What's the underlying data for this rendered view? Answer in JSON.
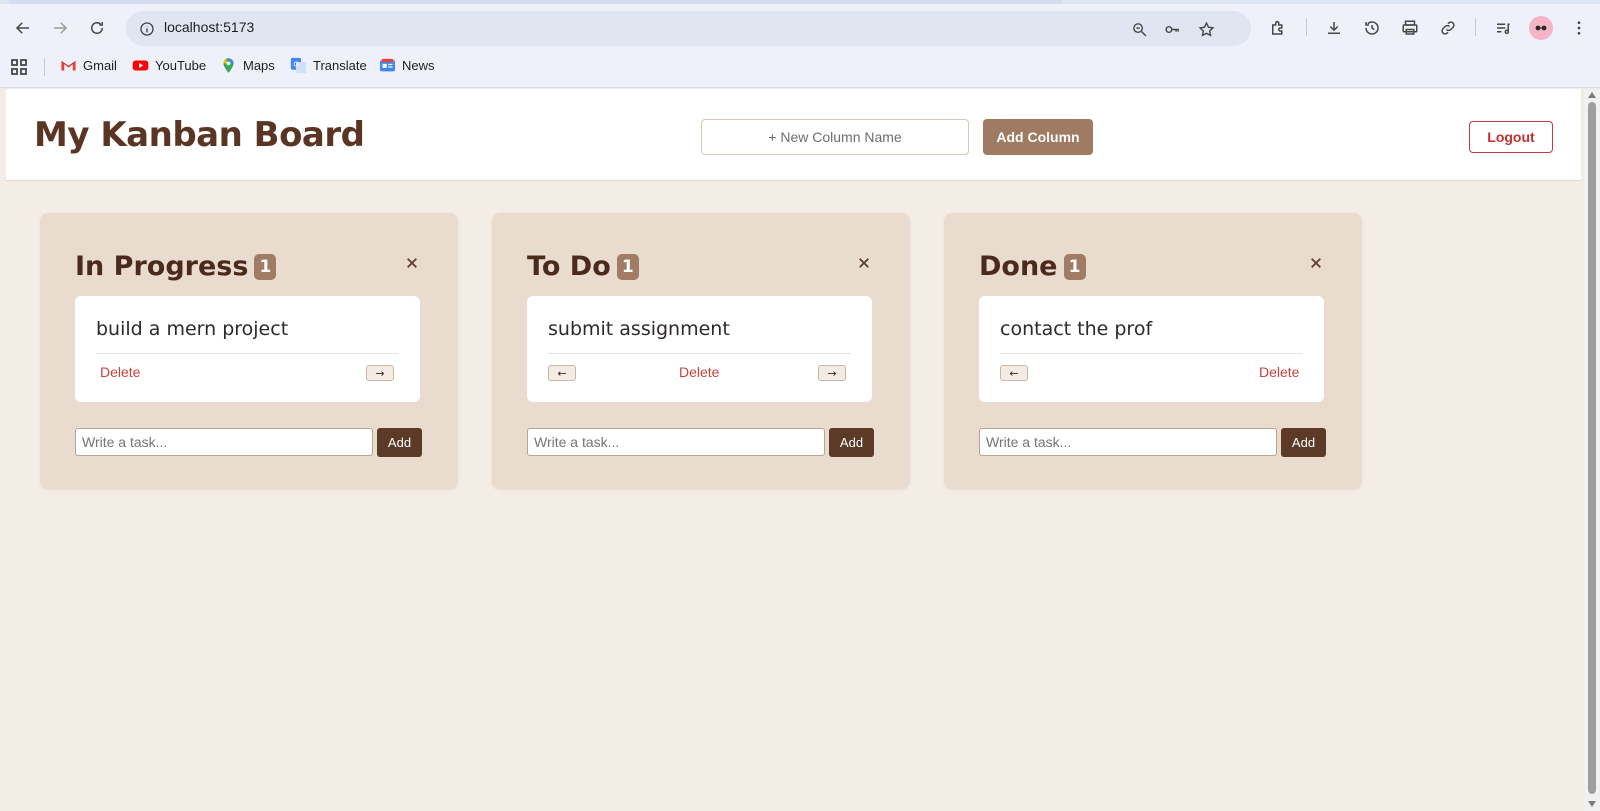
{
  "browser": {
    "url": "localhost:5173",
    "bookmarks": [
      {
        "label": "Gmail",
        "icon": "gmail-icon"
      },
      {
        "label": "YouTube",
        "icon": "youtube-icon"
      },
      {
        "label": "Maps",
        "icon": "maps-icon"
      },
      {
        "label": "Translate",
        "icon": "translate-icon"
      },
      {
        "label": "News",
        "icon": "news-icon"
      }
    ]
  },
  "header": {
    "title": "My Kanban Board",
    "new_column_placeholder": "+ New Column Name",
    "add_column_label": "Add Column",
    "logout_label": "Logout"
  },
  "columns": [
    {
      "title": "In Progress",
      "count": "1",
      "close": "×",
      "cards": [
        {
          "text": "build a mern project",
          "delete_label": "Delete",
          "left_arrow": null,
          "right_arrow": "→"
        }
      ],
      "input_placeholder": "Write a task...",
      "add_label": "Add"
    },
    {
      "title": "To Do",
      "count": "1",
      "close": "×",
      "cards": [
        {
          "text": "submit assignment",
          "delete_label": "Delete",
          "left_arrow": "←",
          "right_arrow": "→"
        }
      ],
      "input_placeholder": "Write a task...",
      "add_label": "Add"
    },
    {
      "title": "Done",
      "count": "1",
      "close": "×",
      "cards": [
        {
          "text": "contact the prof",
          "delete_label": "Delete",
          "left_arrow": "←",
          "right_arrow": null
        }
      ],
      "input_placeholder": "Write a task...",
      "add_label": "Add"
    }
  ],
  "colors": {
    "accent": "#9e7b62",
    "title": "#5a3524",
    "column_bg": "#e9dbcd",
    "delete": "#c8433f",
    "add_button": "#5c3a28"
  }
}
